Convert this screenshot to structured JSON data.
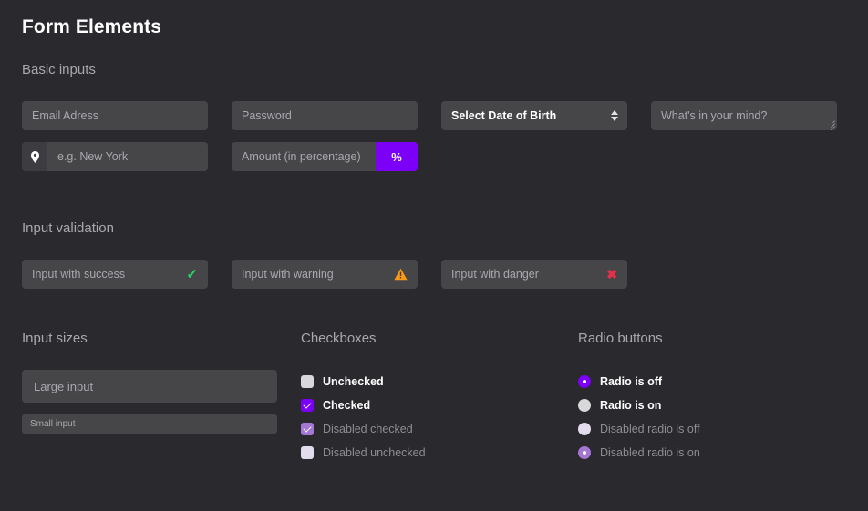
{
  "page": {
    "title": "Form Elements"
  },
  "sections": {
    "basic": {
      "heading": "Basic inputs"
    },
    "validation": {
      "heading": "Input validation"
    },
    "sizes": {
      "heading": "Input sizes"
    },
    "checkboxes": {
      "heading": "Checkboxes"
    },
    "radios": {
      "heading": "Radio buttons"
    }
  },
  "basic_inputs": {
    "email_placeholder": "Email Adress",
    "password_placeholder": "Password",
    "select_value": "Select Date of Birth",
    "textarea_placeholder": "What's in your mind?",
    "city_placeholder": "e.g. New York",
    "city_addon_icon": "location-pin-icon",
    "amount_placeholder": "Amount (in percentage)",
    "amount_addon_label": "%"
  },
  "validation_inputs": [
    {
      "value": "Input with success",
      "icon": "check-icon",
      "state": "success"
    },
    {
      "value": "Input with warning",
      "icon": "warning-triangle-icon",
      "state": "warning"
    },
    {
      "value": "Input with danger",
      "icon": "cross-icon",
      "state": "danger"
    }
  ],
  "input_sizes": {
    "large_placeholder": "Large input",
    "small_placeholder": "Small input"
  },
  "checkbox_options": [
    {
      "label": "Unchecked",
      "checked": false,
      "disabled": false
    },
    {
      "label": "Checked",
      "checked": true,
      "disabled": false
    },
    {
      "label": "Disabled checked",
      "checked": true,
      "disabled": true
    },
    {
      "label": "Disabled unchecked",
      "checked": false,
      "disabled": true
    }
  ],
  "radio_options": [
    {
      "label": "Radio is off",
      "selected": true,
      "disabled": false
    },
    {
      "label": "Radio is on",
      "selected": false,
      "disabled": false
    },
    {
      "label": "Disabled radio is off",
      "selected": false,
      "disabled": true
    },
    {
      "label": "Disabled radio is on",
      "selected": true,
      "disabled": true
    }
  ],
  "colors": {
    "background": "#2a2a2e",
    "input_background": "#464649",
    "accent_purple": "#7c00f8",
    "success_green": "#27d86b",
    "warning_orange": "#f59b16",
    "danger_red": "#e8304a"
  }
}
